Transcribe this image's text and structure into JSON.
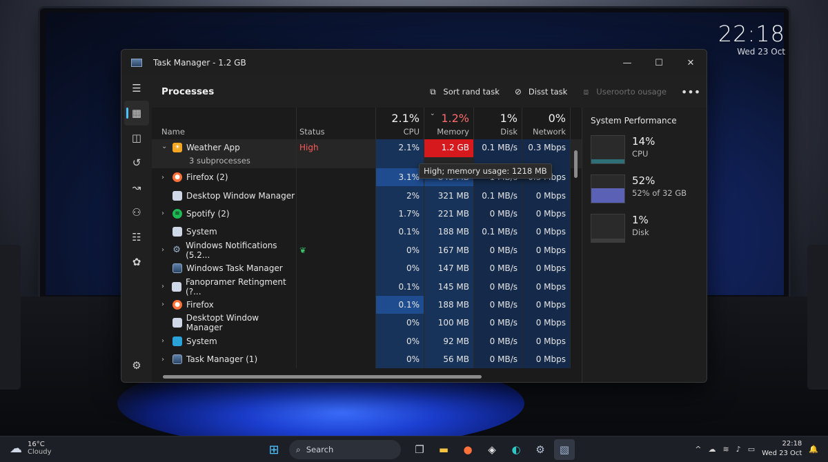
{
  "desktop_clock": {
    "time": "22:18",
    "date": "Wed 23 Oct"
  },
  "window": {
    "title": "Task Manager - 1.2 GB",
    "controls": {
      "minimize": "—",
      "maximize": "☐",
      "close": "✕"
    }
  },
  "nav_rail": [
    {
      "icon": "hamburger-menu-icon"
    },
    {
      "icon": "processes-icon",
      "active": true
    },
    {
      "icon": "app-history-icon"
    },
    {
      "icon": "history-icon"
    },
    {
      "icon": "startup-icon"
    },
    {
      "icon": "users-icon"
    },
    {
      "icon": "details-icon"
    },
    {
      "icon": "services-icon"
    },
    {
      "icon": "settings-icon"
    }
  ],
  "command_bar": {
    "heading": "Processes",
    "sort_label": "Sort rand task",
    "end_label": "Disst task",
    "efficiency_label": "Useroorto ousage",
    "more": "•••"
  },
  "columns": {
    "name": "Name",
    "status": "Status",
    "cpu_label": "CPU",
    "cpu_pct": "2.1%",
    "memory_label": "Memory",
    "memory_pct": "1.2%",
    "disk_label": "Disk",
    "disk_pct": "1%",
    "network_label": "Network",
    "network_pct": "0%"
  },
  "processes": [
    {
      "name": "Weather App",
      "sub": "3 subprocesses",
      "status": "High",
      "cpu": "2.1%",
      "memory": "1.2 GB",
      "disk": "0.1 MB/s",
      "network": "0.3 Mbps",
      "expand": "⌄"
    },
    {
      "name": "Firefox (2)",
      "status": "",
      "cpu": "3.1%",
      "memory": "845 MB",
      "disk": "1 MB/s",
      "network": "0.3 Mbps",
      "expand": "›"
    },
    {
      "name": "Desktop Window Manager",
      "status": "",
      "cpu": "2%",
      "memory": "321 MB",
      "disk": "0.1 MB/s",
      "network": "0 Mbps",
      "expand": ""
    },
    {
      "name": "Spotify (2)",
      "status": "",
      "cpu": "1.7%",
      "memory": "221 MB",
      "disk": "0 MB/s",
      "network": "0 Mbps",
      "expand": "›"
    },
    {
      "name": "System",
      "status": "",
      "cpu": "0.1%",
      "memory": "188 MB",
      "disk": "0.1 MB/s",
      "network": "0 Mbps",
      "expand": ""
    },
    {
      "name": "Windows Notifications (5.2...",
      "status": "",
      "cpu": "0%",
      "memory": "167 MB",
      "disk": "0 MB/s",
      "network": "0 Mbps",
      "expand": "›"
    },
    {
      "name": "Windows Task Manager",
      "status": "",
      "cpu": "0%",
      "memory": "147 MB",
      "disk": "0 MB/s",
      "network": "0 Mbps",
      "expand": ""
    },
    {
      "name": "Fanopramer Retingment (?...",
      "status": "",
      "cpu": "0.1%",
      "memory": "145 MB",
      "disk": "0 MB/s",
      "network": "0 Mbps",
      "expand": "›"
    },
    {
      "name": "Firefox",
      "status": "",
      "cpu": "0.1%",
      "memory": "188 MB",
      "disk": "0 MB/s",
      "network": "0 Mbps",
      "expand": "›"
    },
    {
      "name": "Desktopt Window Manager",
      "status": "",
      "cpu": "0%",
      "memory": "100 MB",
      "disk": "0 MB/s",
      "network": "0 Mbps",
      "expand": ""
    },
    {
      "name": "System",
      "status": "",
      "cpu": "0%",
      "memory": "92 MB",
      "disk": "0 MB/s",
      "network": "0 Mbps",
      "expand": "›"
    },
    {
      "name": "Task Manager (1)",
      "status": "",
      "cpu": "0%",
      "memory": "56 MB",
      "disk": "0 MB/s",
      "network": "0 Mbps",
      "expand": "›"
    }
  ],
  "tooltip": "High; memory usage: 1218 MB",
  "performance": {
    "title": "System Performance",
    "items": [
      {
        "value": "14%",
        "label": "CPU",
        "level": 0.14,
        "color": "#2f6f78"
      },
      {
        "value": "52%",
        "label": "52% of 32 GB",
        "level": 0.52,
        "color": "#5b62b5"
      },
      {
        "value": "1%",
        "label": "Disk",
        "level": 0.01,
        "color": "#3d3d3d"
      }
    ]
  },
  "taskbar": {
    "weather_temp": "16°C",
    "weather_desc": "Cloudy",
    "search_placeholder": "Search",
    "clock_time": "22:18",
    "clock_date": "Wed 23 Oct",
    "tray_chevron": "^"
  }
}
